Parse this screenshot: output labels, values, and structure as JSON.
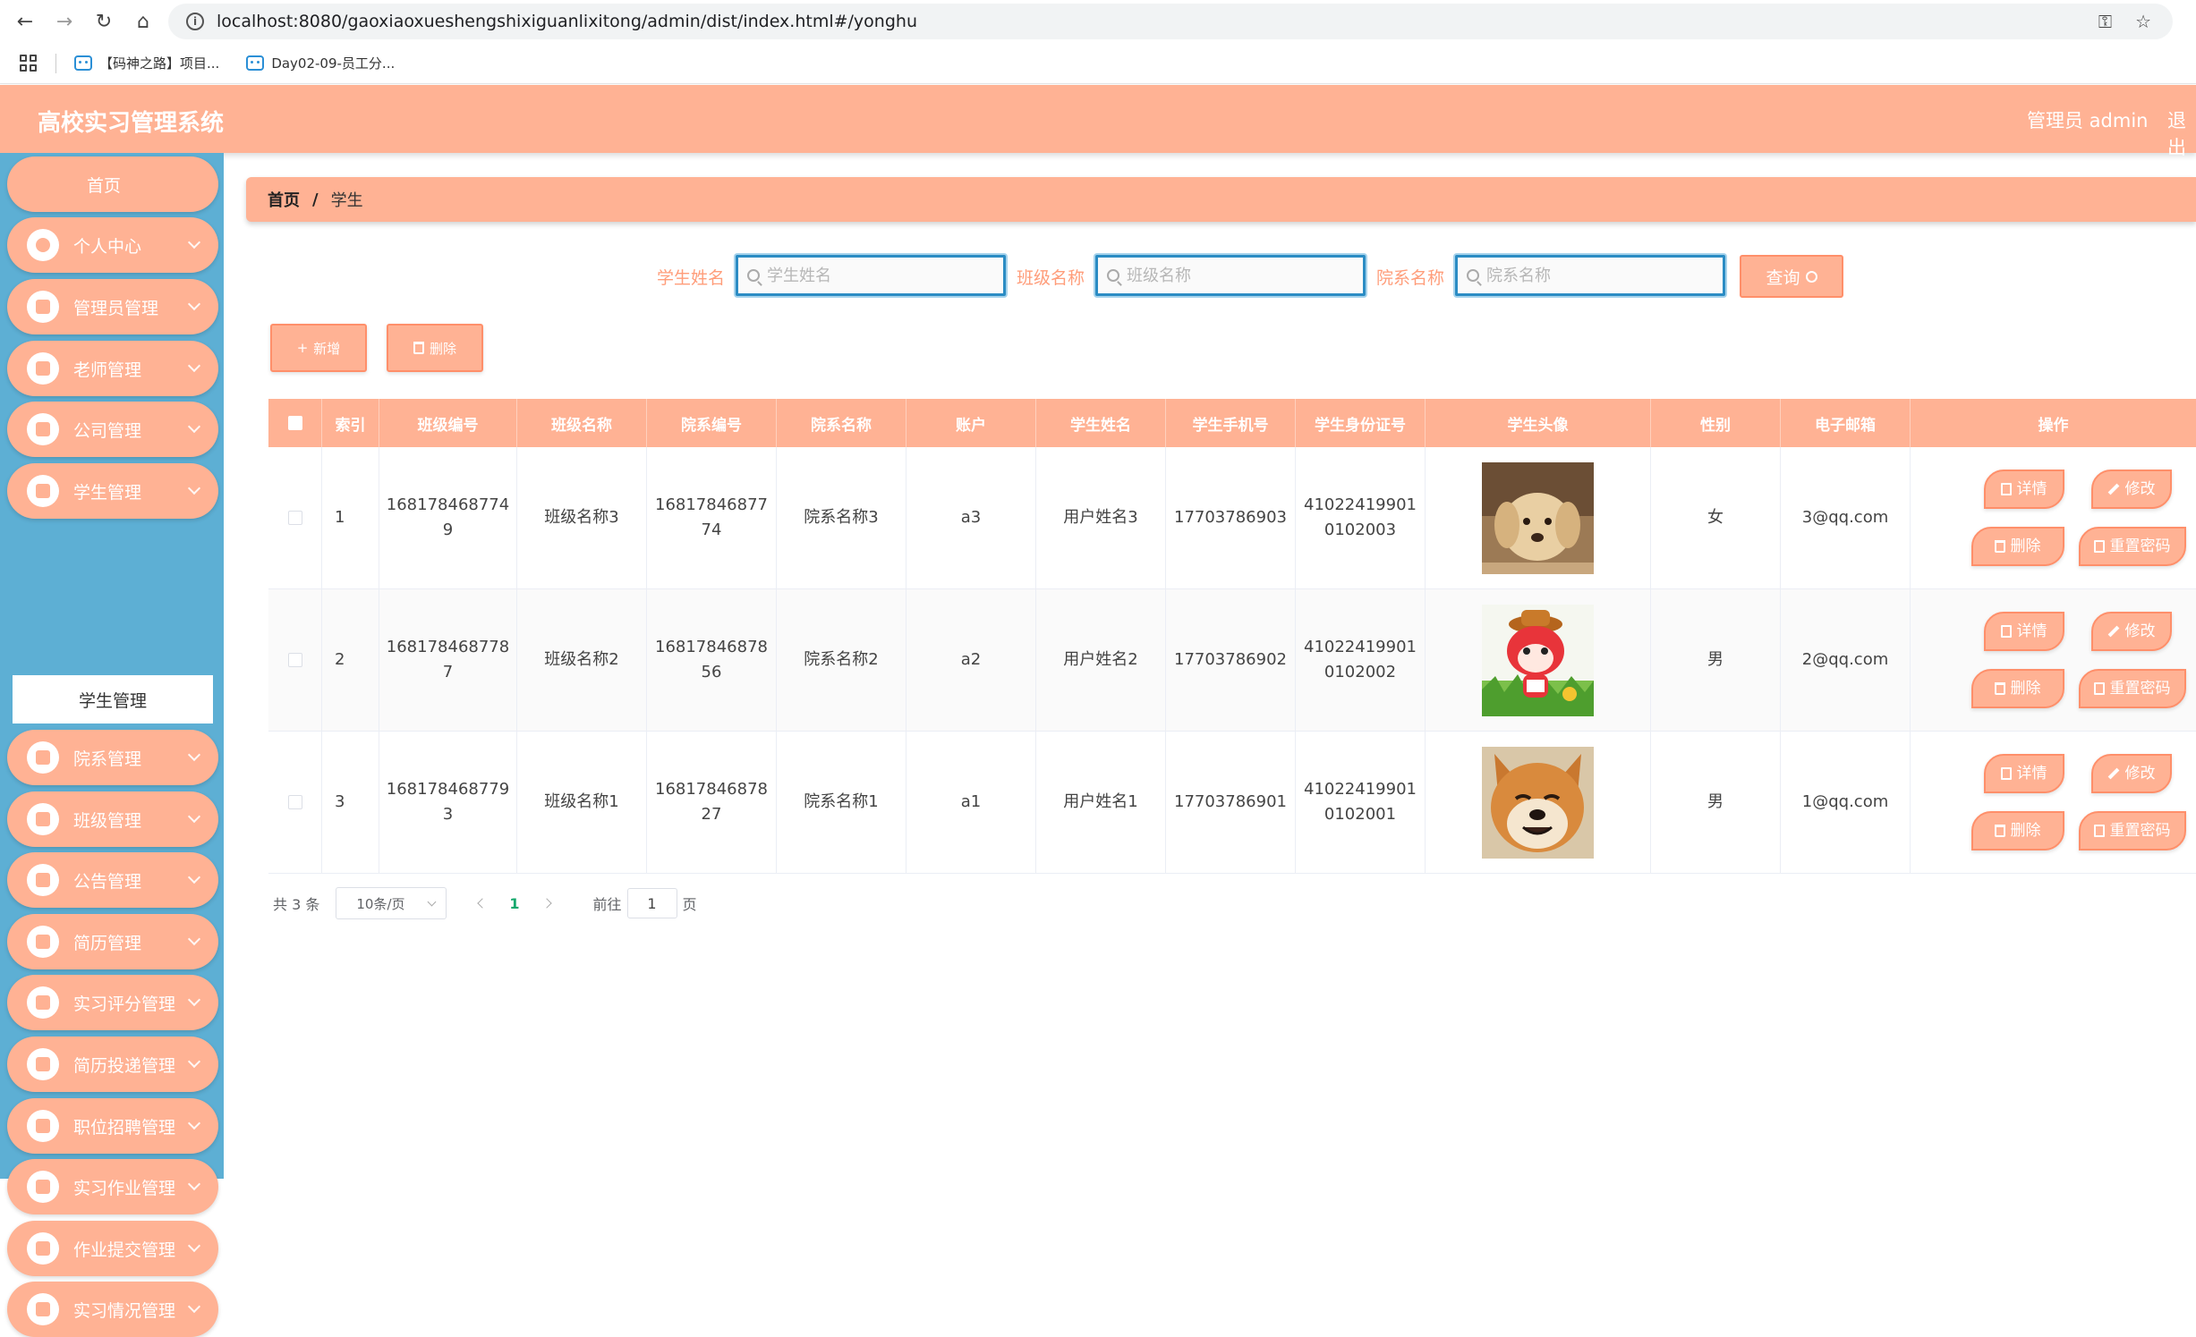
{
  "browser": {
    "url": "localhost:8080/gaoxiaoxueshengshixiguanlixitong/admin/dist/index.html#/yonghu",
    "bookmarks": [
      "【码神之路】项目...",
      "Day02-09-员工分..."
    ]
  },
  "header": {
    "title": "高校实习管理系统",
    "admin_label": "管理员 admin",
    "logout_label": "退出"
  },
  "sidebar": {
    "home": "首页",
    "items": [
      {
        "label": "个人中心",
        "icon": "user-icon"
      },
      {
        "label": "管理员管理",
        "icon": "grid-icon"
      },
      {
        "label": "老师管理",
        "icon": "grid-icon"
      },
      {
        "label": "公司管理",
        "icon": "grid-icon"
      },
      {
        "label": "学生管理",
        "icon": "briefcase-icon"
      },
      {
        "label": "院系管理",
        "icon": "bar-chart-icon"
      },
      {
        "label": "班级管理",
        "icon": "briefcase-icon"
      },
      {
        "label": "公告管理",
        "icon": "grid-icon"
      },
      {
        "label": "简历管理",
        "icon": "list-icon"
      },
      {
        "label": "实习评分管理",
        "icon": "chat-icon"
      },
      {
        "label": "简历投递管理",
        "icon": "grid-icon"
      },
      {
        "label": "职位招聘管理",
        "icon": "send-icon"
      },
      {
        "label": "实习作业管理",
        "icon": "grid-icon"
      },
      {
        "label": "作业提交管理",
        "icon": "grid-icon"
      },
      {
        "label": "实习情况管理",
        "icon": "grid-icon"
      }
    ],
    "submenu_active": "学生管理"
  },
  "breadcrumb": {
    "home": "首页",
    "separator": "/",
    "current": "学生"
  },
  "search": {
    "fields": [
      {
        "label": "学生姓名",
        "placeholder": "学生姓名"
      },
      {
        "label": "班级名称",
        "placeholder": "班级名称"
      },
      {
        "label": "院系名称",
        "placeholder": "院系名称"
      }
    ],
    "query_label": "查询"
  },
  "actions": {
    "add_label": "新增",
    "delete_label": "删除"
  },
  "table": {
    "columns": [
      "索引",
      "班级编号",
      "班级名称",
      "院系编号",
      "院系名称",
      "账户",
      "学生姓名",
      "学生手机号",
      "学生身份证号",
      "学生头像",
      "性别",
      "电子邮箱",
      "操作"
    ],
    "rows": [
      {
        "index": "1",
        "class_no": "1681784687749",
        "class_name": "班级名称3",
        "dept_no": "1681784687774",
        "dept_name": "院系名称3",
        "account": "a3",
        "student_name": "用户姓名3",
        "phone": "17703786903",
        "id_card": "410224199010102003",
        "avatar": "puppy-photo",
        "gender": "女",
        "email": "3@qq.com"
      },
      {
        "index": "2",
        "class_no": "1681784687787",
        "class_name": "班级名称2",
        "dept_no": "1681784687856",
        "dept_name": "院系名称2",
        "account": "a2",
        "student_name": "用户姓名2",
        "phone": "17703786902",
        "id_card": "410224199010102002",
        "avatar": "cartoon-fox",
        "gender": "男",
        "email": "2@qq.com"
      },
      {
        "index": "3",
        "class_no": "1681784687793",
        "class_name": "班级名称1",
        "dept_no": "1681784687827",
        "dept_name": "院系名称1",
        "account": "a1",
        "student_name": "用户姓名1",
        "phone": "17703786901",
        "id_card": "410224199010102001",
        "avatar": "shiba-photo",
        "gender": "男",
        "email": "1@qq.com"
      }
    ],
    "row_ops": {
      "detail": "详情",
      "edit": "修改",
      "delete": "删除",
      "reset": "重置密码"
    }
  },
  "pagination": {
    "total_text": "共 3 条",
    "page_size": "10条/页",
    "current_page": "1",
    "goto_label": "前往",
    "goto_value": "1",
    "page_suffix": "页"
  },
  "colors": {
    "primary": "#ffb294",
    "sidebar": "#5dafd4",
    "accent_text": "#ff9d7a"
  }
}
